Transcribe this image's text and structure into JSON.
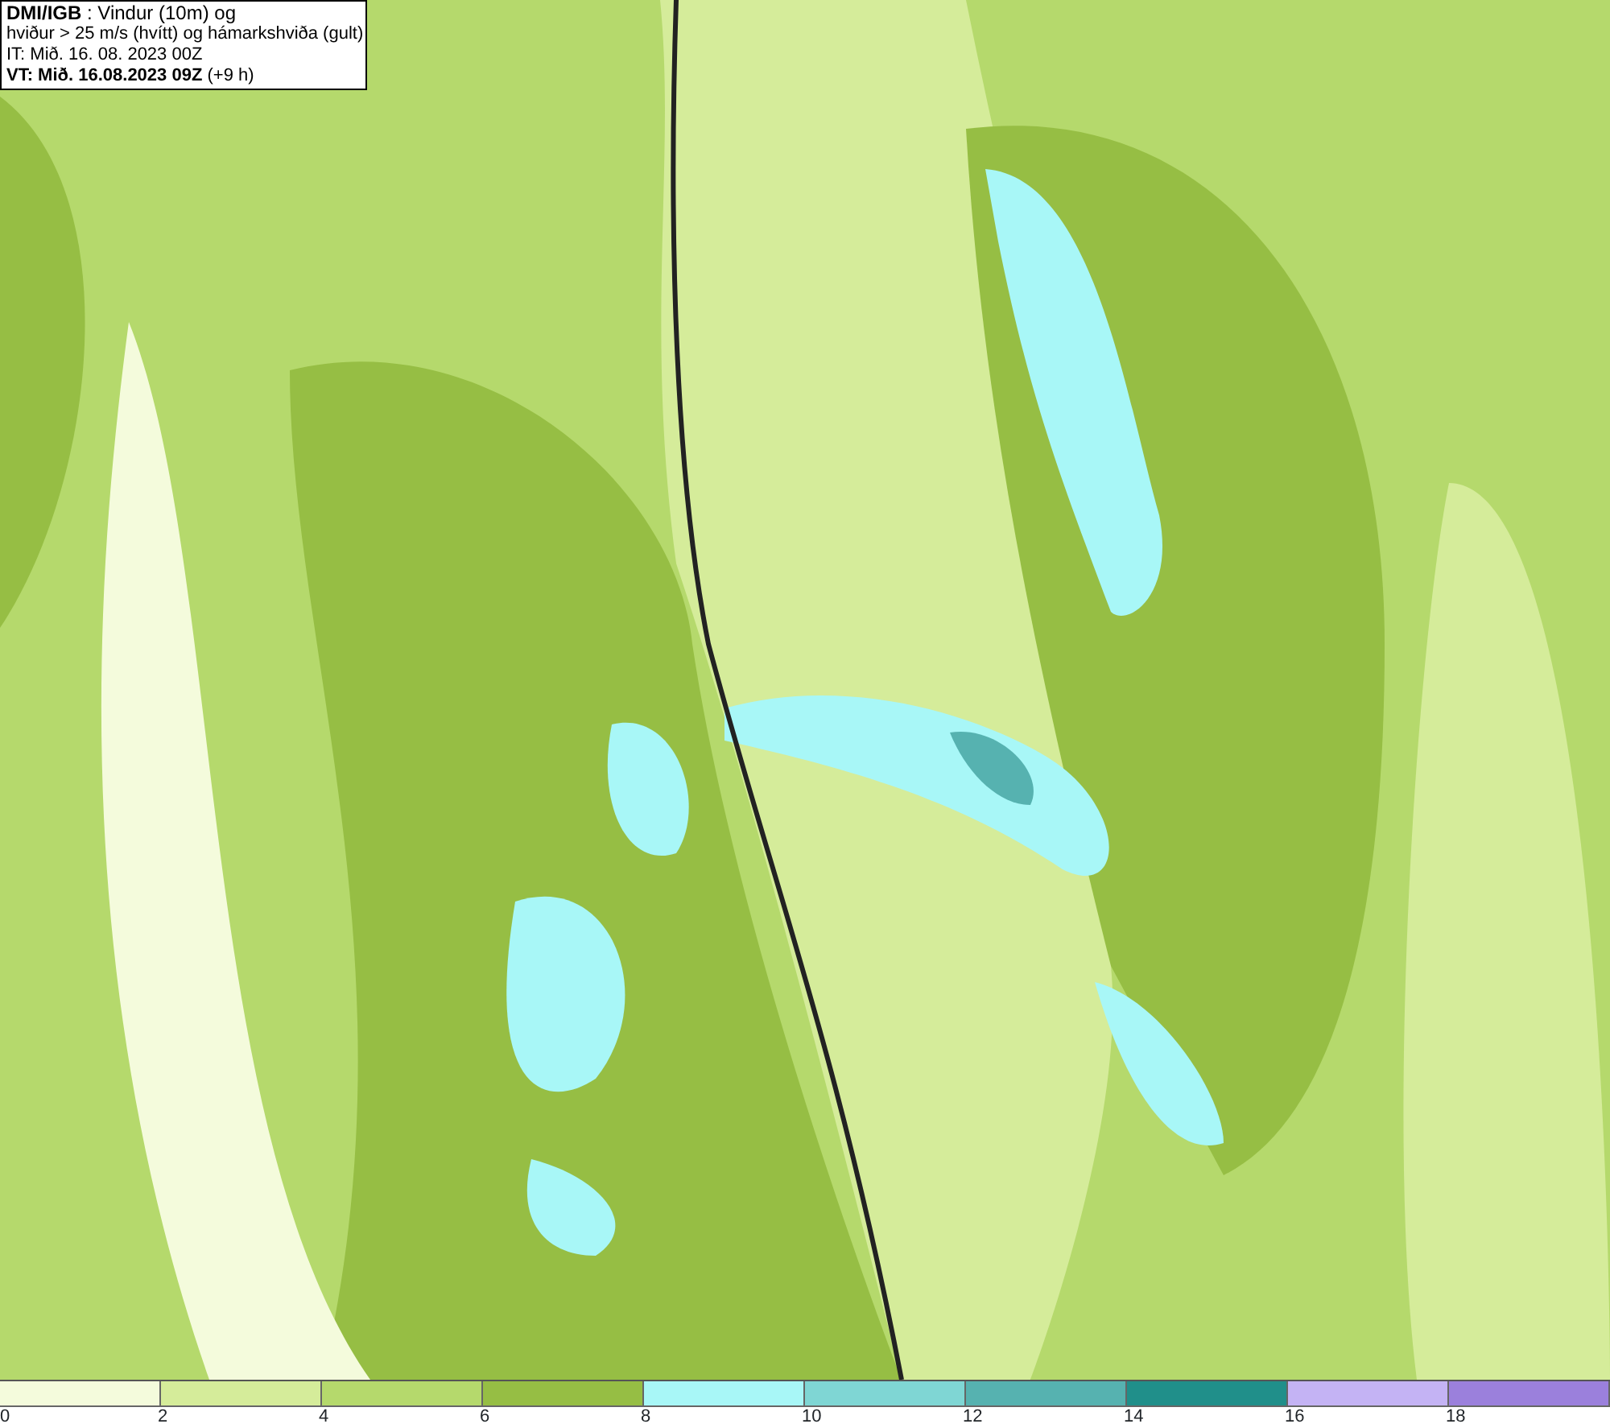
{
  "title_box": {
    "lines": [
      "**DMI/IGB** : Vindur (10m) og",
      "hviður > 25 m/s (hvítt) og hámarkshviða (gult)",
      "IT: Mið. 16. 08. 2023 00Z",
      "**VT: Mið. 16.08.2023 09Z** (+9 h)"
    ]
  },
  "legend": [
    {
      "label": "0",
      "color": "#f4fbdc"
    },
    {
      "label": "2",
      "color": "#d5ec9a"
    },
    {
      "label": "4",
      "color": "#b5d96c"
    },
    {
      "label": "6",
      "color": "#96be44"
    },
    {
      "label": "8",
      "color": "#a8f7f7"
    },
    {
      "label": "10",
      "color": "#7fd6d4"
    },
    {
      "label": "12",
      "color": "#56b2b0"
    },
    {
      "label": "14",
      "color": "#208f8a"
    },
    {
      "label": "16",
      "color": "#c4b3f4"
    },
    {
      "label": "18",
      "color": "#9b80dc"
    }
  ]
}
